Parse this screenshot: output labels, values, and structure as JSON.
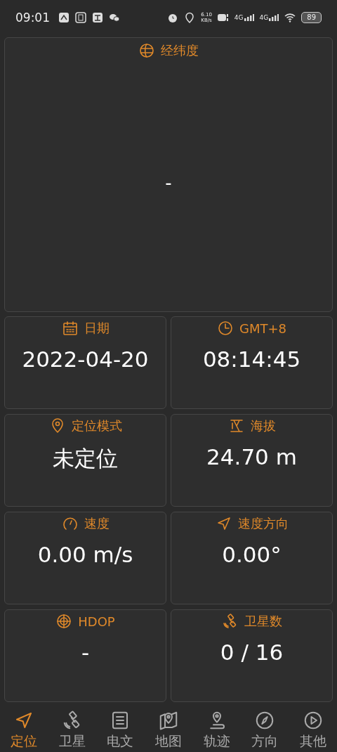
{
  "status_bar": {
    "time": "09:01",
    "net_speed": [
      "6.10",
      "KB/s"
    ],
    "networks": [
      "4G",
      "4G"
    ],
    "battery": "89"
  },
  "coordinates": {
    "kind": "globe",
    "title": "经纬度",
    "value": "-"
  },
  "cards": [
    {
      "kind": "calendar",
      "title": "日期",
      "value": "2022-04-20"
    },
    {
      "kind": "clock",
      "title": "GMT+8",
      "value": "08:14:45"
    },
    {
      "kind": "pin",
      "title": "定位模式",
      "value": "未定位"
    },
    {
      "kind": "altitude",
      "title": "海拔",
      "value": "24.70 m"
    },
    {
      "kind": "gauge",
      "title": "速度",
      "value": "0.00 m/s"
    },
    {
      "kind": "navigation",
      "title": "速度方向",
      "value": "0.00°"
    },
    {
      "kind": "target",
      "title": "HDOP",
      "value": "-"
    },
    {
      "kind": "satellite",
      "title": "卫星数",
      "value": "0 / 16"
    }
  ],
  "nav": [
    {
      "kind": "navigation",
      "label": "定位",
      "selected": true
    },
    {
      "kind": "satellite",
      "label": "卫星",
      "selected": false
    },
    {
      "kind": "document",
      "label": "电文",
      "selected": false
    },
    {
      "kind": "map",
      "label": "地图",
      "selected": false
    },
    {
      "kind": "track",
      "label": "轨迹",
      "selected": false
    },
    {
      "kind": "compass",
      "label": "方向",
      "selected": false
    },
    {
      "kind": "play",
      "label": "其他",
      "selected": false
    }
  ]
}
